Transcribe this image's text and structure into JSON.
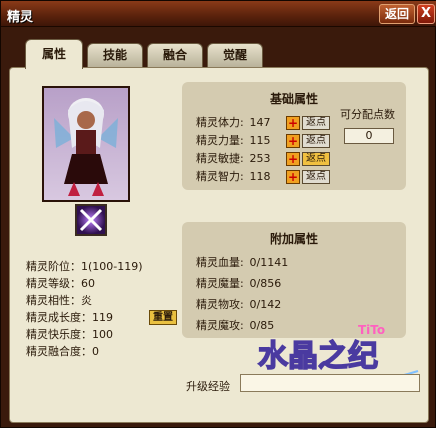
{
  "window": {
    "title": "精灵",
    "back_label": "返回",
    "close_label": "X"
  },
  "tabs": [
    {
      "label": "属性",
      "active": true
    },
    {
      "label": "技能",
      "active": false
    },
    {
      "label": "融合",
      "active": false
    },
    {
      "label": "觉醒",
      "active": false
    }
  ],
  "info": {
    "rank": "精灵阶位：1(100-119)",
    "level": "精灵等级：60",
    "affinity": "精灵相性：炎",
    "growth": "精灵成长度：119",
    "happiness": "精灵快乐度：100",
    "fusion": "精灵融合度：0",
    "reset_label": "重置"
  },
  "base_attrs": {
    "title": "基础属性",
    "points_label": "可分配点数",
    "points_value": "0",
    "return_label": "返点",
    "rows": [
      {
        "label": "精灵体力:",
        "value": "147",
        "highlight": false
      },
      {
        "label": "精灵力量:",
        "value": "115",
        "highlight": false
      },
      {
        "label": "精灵敏捷:",
        "value": "253",
        "highlight": true
      },
      {
        "label": "精灵智力:",
        "value": "118",
        "highlight": false
      }
    ]
  },
  "extra_attrs": {
    "title": "附加属性",
    "rows": [
      {
        "label": "精灵血量:",
        "value": "0/1141"
      },
      {
        "label": "精灵魔量:",
        "value": "0/856"
      },
      {
        "label": "精灵物攻:",
        "value": "0/142"
      },
      {
        "label": "精灵魔攻:",
        "value": "0/85"
      }
    ]
  },
  "exp": {
    "label": "升级经验",
    "progress": 0
  },
  "logo": {
    "text": "水晶之纪",
    "version": "TiTo"
  },
  "colors": {
    "accent": "#e9c040",
    "panel": "#ede8d2",
    "titlebar": "#5a220c"
  }
}
